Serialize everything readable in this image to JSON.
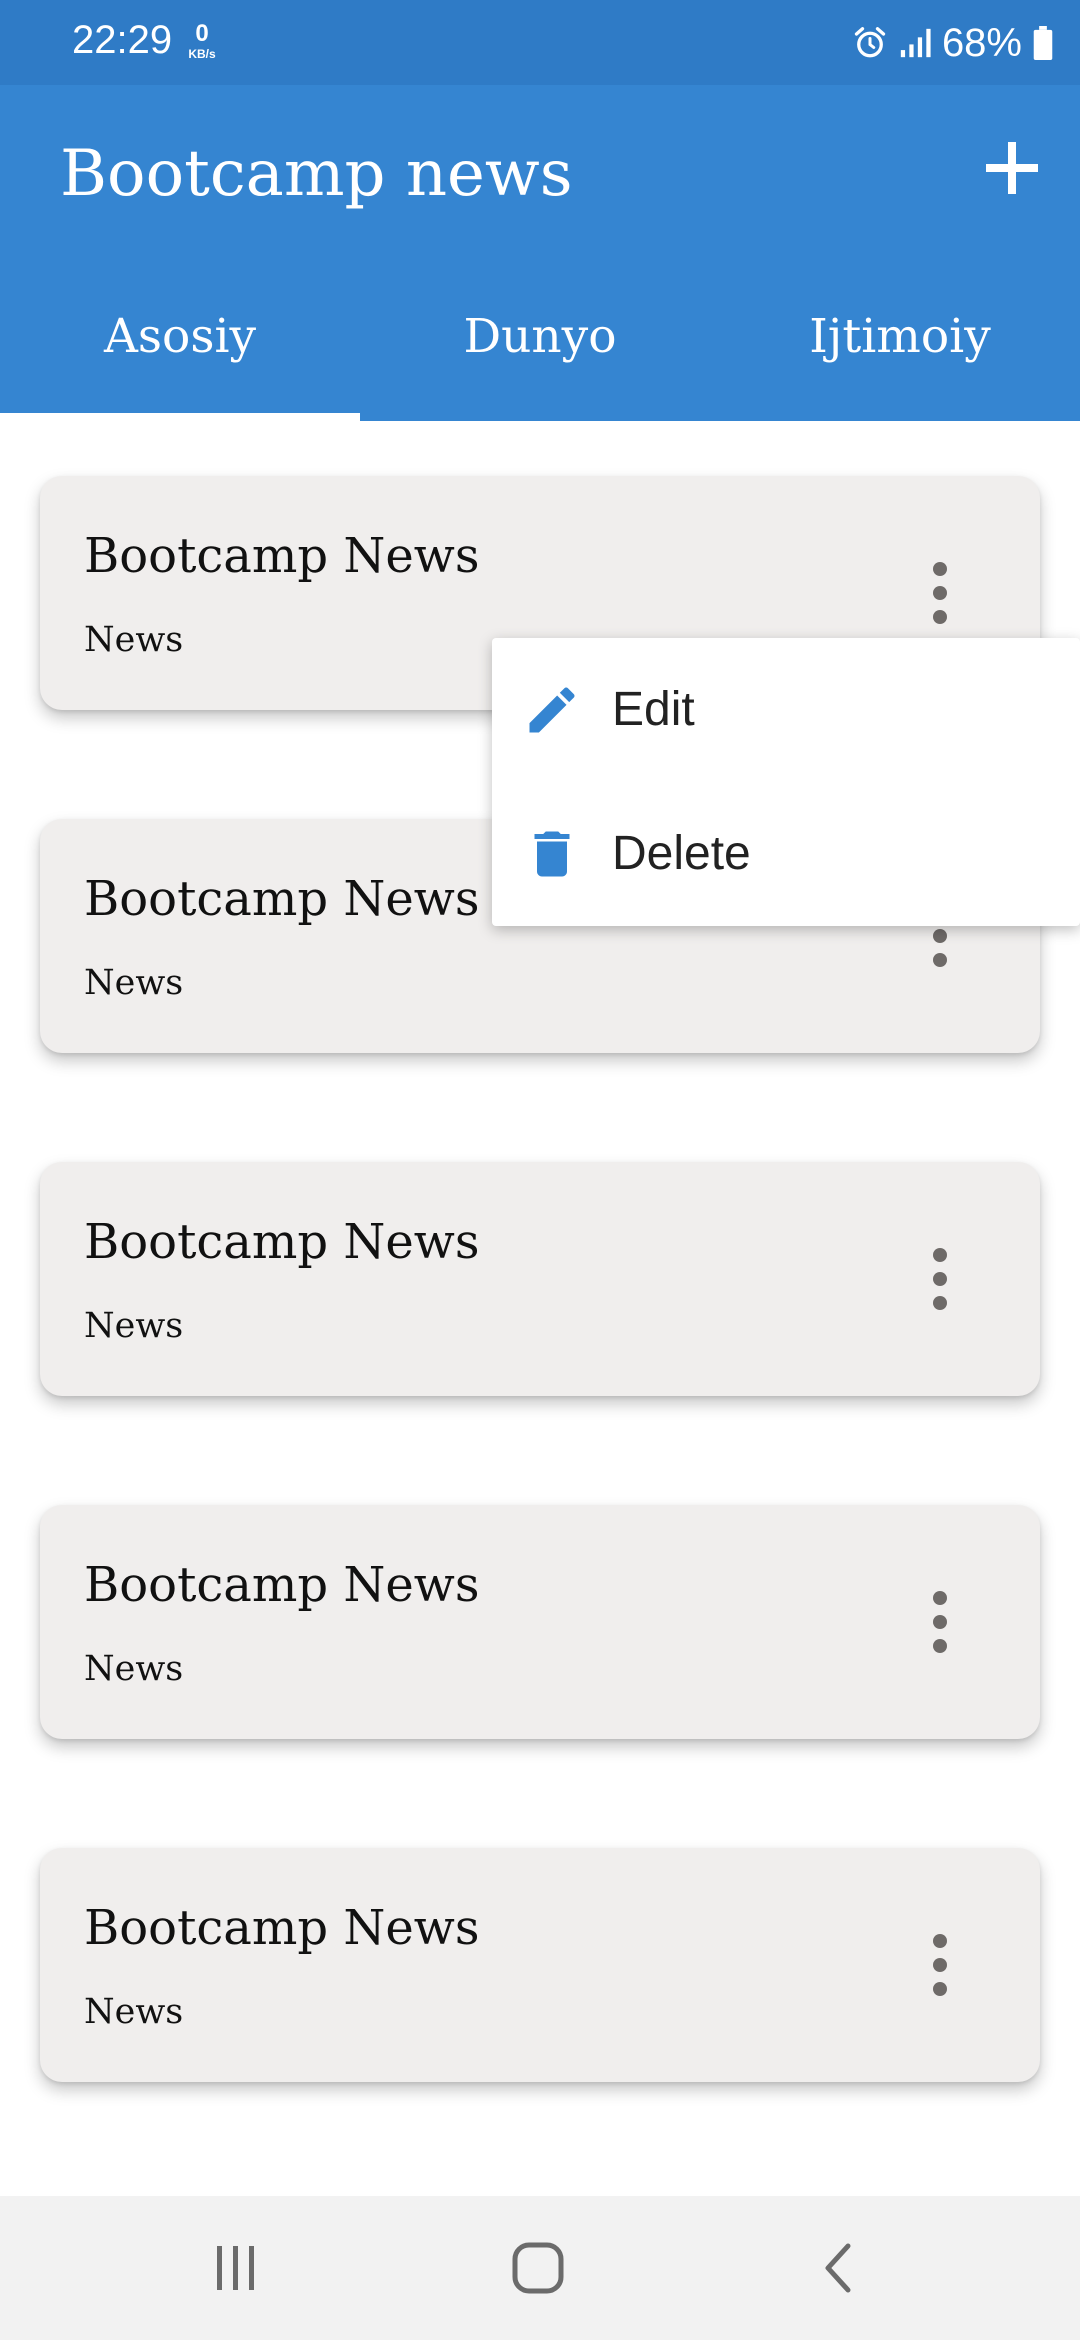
{
  "status_bar": {
    "time": "22:29",
    "net_speed_value": "0",
    "net_speed_unit": "KB/s",
    "battery_percent": "68%",
    "icons": [
      "alarm-icon",
      "signal-icon",
      "battery-icon"
    ]
  },
  "app_bar": {
    "title": "Bootcamp news",
    "add_icon": "plus-icon",
    "color": "#3585d1"
  },
  "tabs": [
    {
      "label": "Asosiy",
      "selected": true
    },
    {
      "label": "Dunyo",
      "selected": false
    },
    {
      "label": "Ijtimoiy",
      "selected": false
    }
  ],
  "news": [
    {
      "title": "Bootcamp News",
      "subtitle": "News"
    },
    {
      "title": "Bootcamp News",
      "subtitle": "News"
    },
    {
      "title": "Bootcamp News",
      "subtitle": "News"
    },
    {
      "title": "Bootcamp News",
      "subtitle": "News"
    },
    {
      "title": "Bootcamp News",
      "subtitle": "News"
    }
  ],
  "popup_menu": {
    "items": [
      {
        "label": "Edit",
        "icon": "pencil-icon"
      },
      {
        "label": "Delete",
        "icon": "trash-icon"
      }
    ],
    "icon_color": "#3585d1"
  },
  "nav_bar": {
    "icons": [
      "recent-apps-icon",
      "home-icon",
      "back-icon"
    ]
  }
}
